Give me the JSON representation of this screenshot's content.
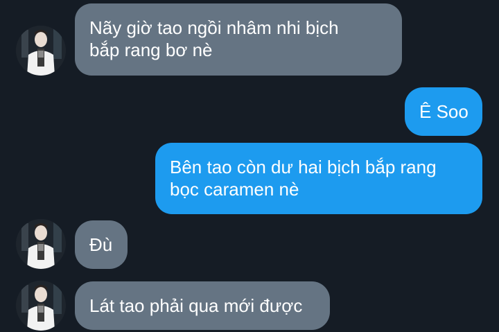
{
  "messages": [
    {
      "direction": "incoming",
      "lines": [
        "Nãy giờ tao ngồi nhâm nhi bịch",
        "bắp rang bơ nè"
      ]
    },
    {
      "direction": "outgoing",
      "lines": [
        "Ê Soo"
      ]
    },
    {
      "direction": "outgoing",
      "lines": [
        "Bên tao còn dư hai bịch bắp rang",
        "bọc caramen nè"
      ]
    },
    {
      "direction": "incoming",
      "lines": [
        "Đù"
      ]
    },
    {
      "direction": "incoming",
      "lines": [
        "Lát tao phải qua mới được"
      ]
    }
  ],
  "colors": {
    "background": "#151c25",
    "incoming_bubble": "#657483",
    "outgoing_bubble": "#1d9bef",
    "text": "#ffffff"
  }
}
